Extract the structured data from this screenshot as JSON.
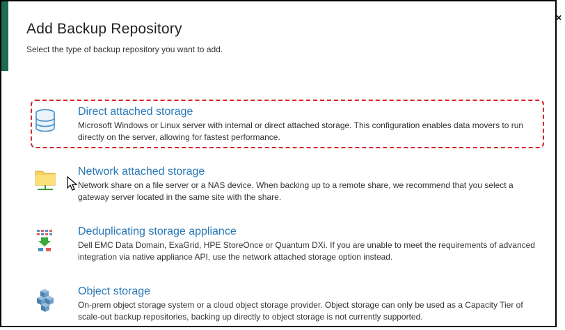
{
  "dialog": {
    "title": "Add Backup Repository",
    "subtitle": "Select the type of backup repository you want to add.",
    "close_glyph": "×"
  },
  "options": [
    {
      "title": "Direct attached storage",
      "description": "Microsoft Windows or Linux server with internal or direct attached storage. This configuration enables data movers to run directly on the server, allowing for fastest performance.",
      "icon": "database-icon",
      "selected": true
    },
    {
      "title": "Network attached storage",
      "description": "Network share on a file server or a NAS device. When backing up to a remote share, we recommend that you select a gateway server located in the same site with the share.",
      "icon": "network-folder-icon",
      "selected": false
    },
    {
      "title": "Deduplicating storage appliance",
      "description": "Dell EMC Data Domain, ExaGrid, HPE StoreOnce or Quantum DXi. If you are unable to meet the requirements of advanced integration via native appliance API, use the network attached storage option instead.",
      "icon": "deduplication-icon",
      "selected": false
    },
    {
      "title": "Object storage",
      "description": "On-prem object storage system or a cloud object storage provider. Object storage can only be used as a Capacity Tier of scale-out backup repositories, backing up directly to object storage is not currently supported.",
      "icon": "object-storage-icon",
      "selected": false
    }
  ],
  "colors": {
    "accent": "#1f6b52",
    "link": "#2677b7",
    "highlight": "#d7262a"
  }
}
